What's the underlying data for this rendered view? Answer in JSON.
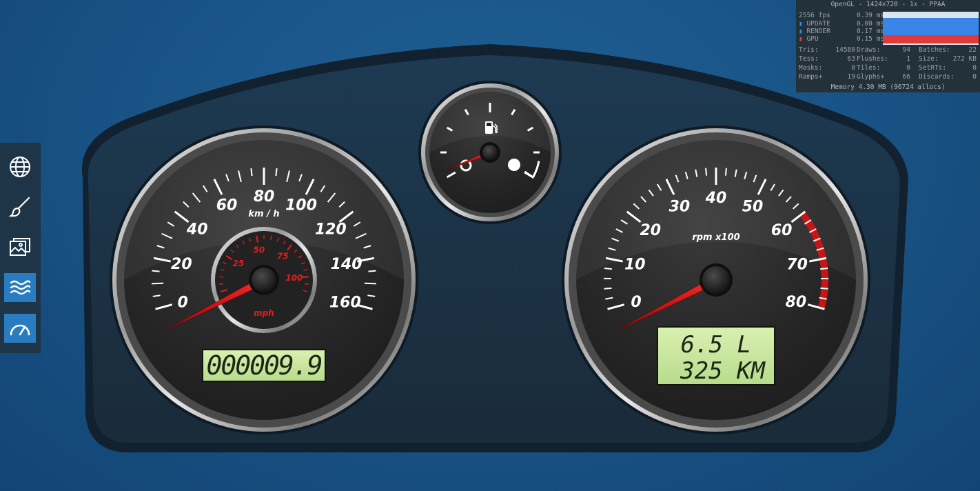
{
  "sidebar": {
    "items": [
      {
        "icon": "globe-icon",
        "active": false
      },
      {
        "icon": "brush-icon",
        "active": false
      },
      {
        "icon": "images-icon",
        "active": false
      },
      {
        "icon": "waves-icon",
        "active": true
      },
      {
        "icon": "gauge-icon",
        "active": true
      }
    ]
  },
  "perf": {
    "title": "OpenGL - 1424x720 - 1x - PPAA",
    "fps": "2556 fps",
    "fps_ms": "0.39 ms",
    "update_label": "UPDATE",
    "update_ms": "0.00 ms",
    "render_label": "RENDER",
    "render_ms": "0.17 ms",
    "gpu_label": "GPU",
    "gpu_ms": "0.15 ms",
    "stats": [
      [
        "Tris:",
        "14580",
        "Draws:",
        "94",
        "Batches:",
        "22"
      ],
      [
        "Tess:",
        "63",
        "Flushes:",
        "1",
        "Size:",
        "272 KB"
      ],
      [
        "Masks:",
        "0",
        "Tiles:",
        "0",
        "SetRTs:",
        "0"
      ],
      [
        "Ramps+",
        "19",
        "Glyphs+",
        "66",
        "Discards:",
        "0"
      ]
    ],
    "memory": "Memory 4.30 MB (96724 allocs)"
  },
  "speedometer": {
    "unit": "km / h",
    "labels": [
      "0",
      "20",
      "40",
      "60",
      "80",
      "100",
      "120",
      "140",
      "160"
    ],
    "value_kmh": 0,
    "odometer": "000009.9"
  },
  "mph_gauge": {
    "unit": "mph",
    "labels": [
      "25",
      "50",
      "75",
      "100"
    ]
  },
  "fuel_gauge": {
    "icon": "fuel-pump-icon",
    "level": 0
  },
  "tachometer": {
    "unit": "rpm x100",
    "labels": [
      "0",
      "10",
      "20",
      "30",
      "40",
      "50",
      "60",
      "70",
      "80"
    ],
    "value_rpm_x100": 0,
    "lcd_line1": "6.5 L",
    "lcd_line2": "325 KM"
  }
}
